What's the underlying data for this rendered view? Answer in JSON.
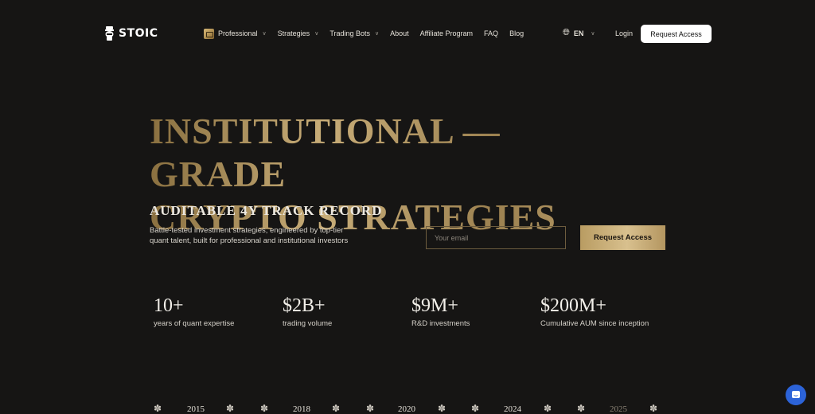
{
  "brand": {
    "name": "STOIC"
  },
  "nav": {
    "items": [
      {
        "label": "Professional",
        "has_dropdown": true,
        "icon": "briefcase-icon"
      },
      {
        "label": "Strategies",
        "has_dropdown": true
      },
      {
        "label": "Trading Bots",
        "has_dropdown": true
      },
      {
        "label": "About",
        "has_dropdown": false
      },
      {
        "label": "Affiliate Program",
        "has_dropdown": false
      },
      {
        "label": "FAQ",
        "has_dropdown": false
      },
      {
        "label": "Blog",
        "has_dropdown": false
      }
    ],
    "language": "EN",
    "login": "Login",
    "request_access": "Request Access"
  },
  "hero": {
    "title_line1": "INSTITUTIONAL — GRADE",
    "title_line2": "CRYPTO STRATEGIES",
    "subtitle": "AUDITABLE 4Y TRACK RECORD",
    "description": "Battle-tested investment strategies, engineered by top-tier quant talent, built for professional and institutional investors",
    "email_placeholder": "Your email",
    "cta": "Request Access"
  },
  "stats": [
    {
      "value": "10+",
      "label": "years of quant expertise"
    },
    {
      "value": "$2B+",
      "label": "trading volume"
    },
    {
      "value": "$9M+",
      "label": "R&D investments"
    },
    {
      "value": "$200M+",
      "label": "Cumulative AUM since inception"
    }
  ],
  "timeline": {
    "years": [
      "2015",
      "2018",
      "2020",
      "2024",
      "2025"
    ],
    "active_year": "2025"
  },
  "colors": {
    "background": "#161514",
    "gold": "#c2a56f",
    "chat": "#2c63d8"
  }
}
